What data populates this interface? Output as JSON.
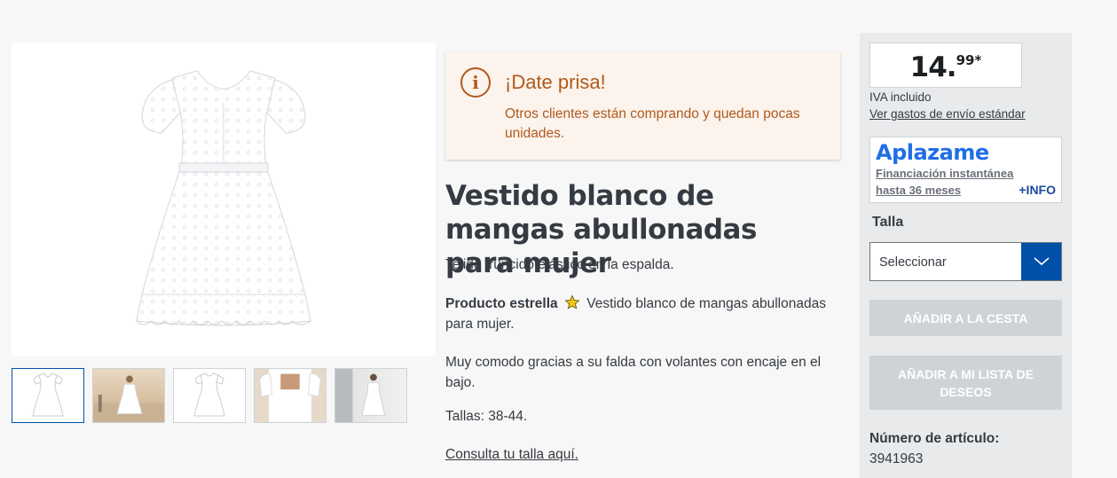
{
  "gallery": {
    "thumbnail_count": 5
  },
  "hurry": {
    "icon": "info-icon",
    "title": "¡Date prisa!",
    "text": "Otros clientes están comprando y quedan pocas unidades."
  },
  "product": {
    "title": "Vestido blanco de mangas abullonadas para mujer",
    "subtitle": "Tejido fruncido elástico en la espalda.",
    "highlight_label": "Producto estrella",
    "highlight_text": "Vestido blanco de mangas abullonadas para mujer.",
    "description": "Muy comodo gracias a su falda con volantes con encaje en el bajo.",
    "sizes": "Tallas: 38-44.",
    "size_link": "Consulta tu talla aquí."
  },
  "buybox": {
    "price_main": "14.",
    "price_sup": "99*",
    "vat": "IVA incluido",
    "shipping_link": "Ver gastos de envío estándar",
    "aplazame": {
      "logo": "Aplazame",
      "line1": "Financiación instantánea",
      "line2": "hasta 36 meses",
      "info": "+INFO"
    },
    "size_label": "Talla",
    "size_select": "Seleccionar",
    "add_to_cart": "AÑADIR A LA CESTA",
    "add_to_wishlist": "AÑADIR A MI LISTA DE DESEOS",
    "article_label": "Número de artículo:",
    "article_number": "3941963"
  },
  "colors": {
    "accent_blue": "#0050aa",
    "hurry_orange": "#b05a1c",
    "disabled_button": "#cfd3d7"
  }
}
